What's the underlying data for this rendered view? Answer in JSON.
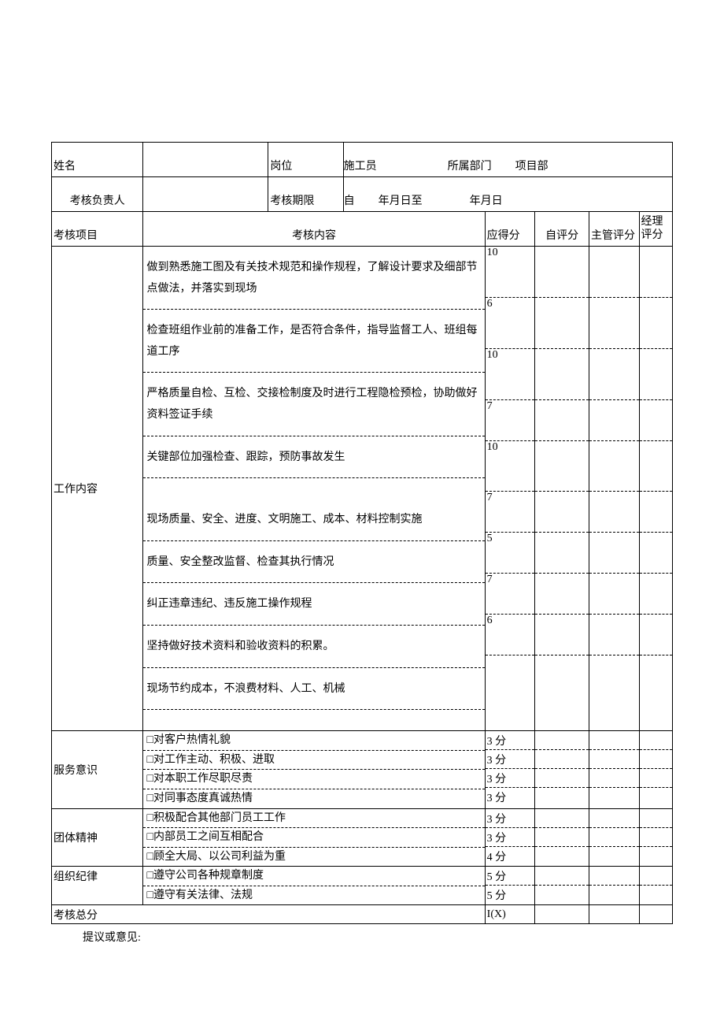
{
  "header": {
    "name_label": "姓名",
    "name_value": "",
    "post_label": "岗位",
    "post_value": "施工员",
    "dept_label": "所属部门",
    "dept_value": "项目部",
    "reviewer_label": "考核负责人",
    "reviewer_value": "",
    "period_label": "考核期限",
    "period_from_prefix": "自",
    "period_from": "年月日至",
    "period_to": "年月日"
  },
  "cols": {
    "item": "考核项目",
    "content": "考核内容",
    "max": "应得分",
    "self": "自评分",
    "sup": "主管评分",
    "mgr": "经理评分"
  },
  "sections": {
    "work": {
      "title": "工作内容",
      "rows": [
        {
          "text": "做到熟悉施工图及有关技术规范和操作规程，了解设计要求及细部节点做法，并落实到现场",
          "score": "10"
        },
        {
          "text": "检查班组作业前的准备工作，是否符合条件，指导监督工人、班组每道工序",
          "score": "6"
        },
        {
          "text": "严格质量自检、互检、交接检制度及时进行工程隐检预检，协助做好资料签证手续",
          "score": "10"
        },
        {
          "text": "关键部位加强检查、跟踪，预防事故发生",
          "score": "7"
        },
        {
          "text": "现场质量、安全、进度、文明施工、成本、材料控制实施",
          "score": "10"
        },
        {
          "text": "质量、安全整改监督、检查其执行情况",
          "score": "7"
        },
        {
          "text": "纠正违章违纪、违反施工操作规程",
          "score": "5"
        },
        {
          "text": "坚持做好技术资料和验收资料的积累。",
          "score": "7"
        },
        {
          "text": "现场节约成本，不浪费材料、人工、机械",
          "score": "6"
        },
        {
          "text": "",
          "score": ""
        }
      ]
    },
    "service": {
      "title": "服务意识",
      "rows": [
        {
          "text": "□对客户热情礼貌",
          "score": "3 分"
        },
        {
          "text": "□对工作主动、积极、进取",
          "score": "3 分"
        },
        {
          "text": "□对本职工作尽职尽责",
          "score": "3 分"
        },
        {
          "text": "□对同事态度真诚热情",
          "score": "3 分"
        }
      ]
    },
    "team": {
      "title": "团体精神",
      "rows": [
        {
          "text": "□积极配合其他部门员工工作",
          "score": "3 分"
        },
        {
          "text": "□内部员工之间互相配合",
          "score": "3 分"
        },
        {
          "text": "□顾全大局、以公司利益为重",
          "score": "4 分"
        }
      ]
    },
    "discipline": {
      "title": "组织纪律",
      "rows": [
        {
          "text": "□遵守公司各种规章制度",
          "score": "5 分"
        },
        {
          "text": "□遵守有关法律、法规",
          "score": "5 分"
        }
      ]
    }
  },
  "total": {
    "label": "考核总分",
    "score": "I(X)"
  },
  "footnote": "提议或意见:"
}
